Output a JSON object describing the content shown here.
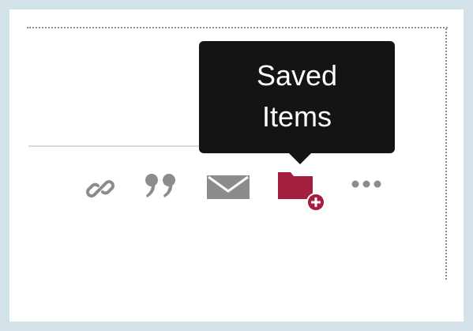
{
  "tooltip": {
    "line1": "Saved",
    "line2": "Items"
  },
  "toolbar": {
    "icons": [
      "link-icon",
      "quote-icon",
      "email-icon",
      "saved-items-folder-icon",
      "more-icon"
    ]
  },
  "colors": {
    "background": "#d3e1e8",
    "panel": "#ffffff",
    "tooltip_bg": "#141414",
    "icon_gray": "#8c8c8c",
    "accent_crimson": "#a31f3f"
  }
}
